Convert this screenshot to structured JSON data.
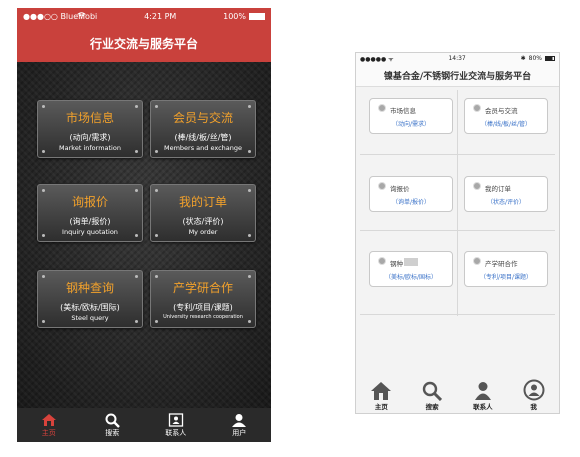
{
  "left_phone": {
    "status": {
      "carrier": "●●●○○ BlueMobi",
      "wifi_icon": "wifi-icon",
      "time": "4:21 PM",
      "battery": "100%"
    },
    "title": "行业交流与服务平台",
    "tiles": [
      {
        "title": "市场信息",
        "sub_cn": "(动向/需求)",
        "sub_en": "Market information"
      },
      {
        "title": "会员与交流",
        "sub_cn": "(棒/线/板/丝/管)",
        "sub_en": "Members and exchange"
      },
      {
        "title": "询报价",
        "sub_cn": "(询单/报价)",
        "sub_en": "Inquiry quotation"
      },
      {
        "title": "我的订单",
        "sub_cn": "(状态/评价)",
        "sub_en": "My order"
      },
      {
        "title": "钢种查询",
        "sub_cn": "(美标/欧标/国际)",
        "sub_en": "Steel query"
      },
      {
        "title": "产学研合作",
        "sub_cn": "(专利/项目/课题)",
        "sub_en": "University research cooperation"
      }
    ],
    "tabs": [
      {
        "label": "主页",
        "icon": "home-icon"
      },
      {
        "label": "搜索",
        "icon": "search-icon"
      },
      {
        "label": "联系人",
        "icon": "contacts-icon"
      },
      {
        "label": "用户",
        "icon": "user-icon"
      }
    ],
    "accent_color": "#c9413c",
    "tile_title_color": "#f2a12b"
  },
  "right_phone": {
    "status": {
      "carrier": "●●●●● ᯤ",
      "time": "14:37",
      "bluetooth": "✱",
      "battery": "80%"
    },
    "title": "镍基合金/不锈钢行业交流与服务平台",
    "tiles": [
      {
        "title": "市场信息",
        "sub": "（动向/需求）"
      },
      {
        "title": "会员与交流",
        "sub": "（棒/线/板/丝/管）"
      },
      {
        "title": "询报价",
        "sub": "（询单/报价）"
      },
      {
        "title": "我的订单",
        "sub": "（状态/评价）"
      },
      {
        "title": "钢种",
        "sub": "（美标/欧标/国标）"
      },
      {
        "title": "产学研合作",
        "sub": "（专利/项目/课题）"
      }
    ],
    "tabs": [
      {
        "label": "主页",
        "icon": "home-icon"
      },
      {
        "label": "搜索",
        "icon": "search-icon"
      },
      {
        "label": "联系人",
        "icon": "contacts-icon"
      },
      {
        "label": "我",
        "icon": "me-icon"
      }
    ],
    "subtitle_color": "#3a72c8"
  }
}
